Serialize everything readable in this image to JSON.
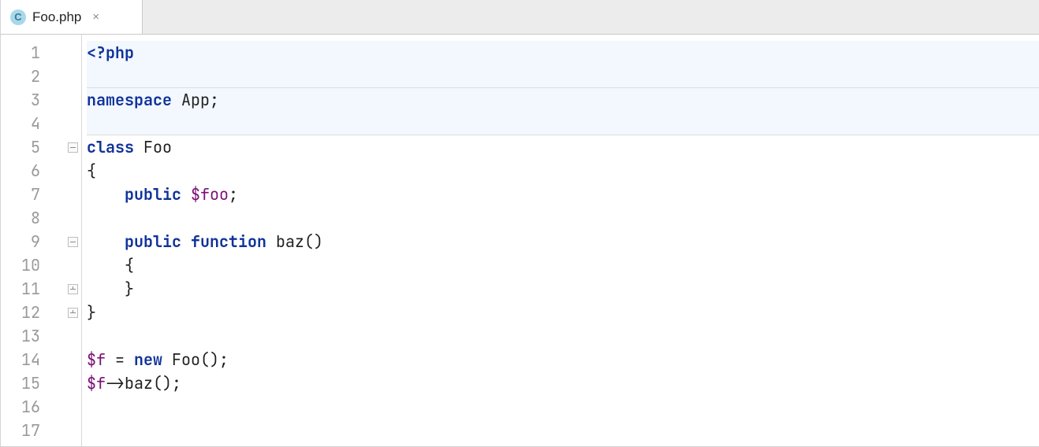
{
  "tab": {
    "icon_letter": "C",
    "filename": "Foo.php",
    "close_glyph": "×"
  },
  "editor": {
    "line_count": 17,
    "highlighted_lines": [
      1,
      2,
      3,
      4
    ],
    "fold_markers": {
      "5": "open",
      "9": "open",
      "11": "close",
      "12": "close"
    },
    "code": {
      "l1": {
        "open": "<?php"
      },
      "l3": {
        "kw": "namespace",
        "name": " App",
        "end": ";"
      },
      "l5": {
        "kw": "class",
        "name": " Foo"
      },
      "l6": {
        "brace": "{"
      },
      "l7": {
        "indent": "    ",
        "kw": "public",
        "sp": " ",
        "var": "$foo",
        "end": ";"
      },
      "l9": {
        "indent": "    ",
        "kw1": "public",
        "sp1": " ",
        "kw2": "function",
        "name": " baz",
        "paren": "()"
      },
      "l10": {
        "indent": "    ",
        "brace": "{"
      },
      "l11": {
        "indent": "    ",
        "brace": "}"
      },
      "l12": {
        "brace": "}"
      },
      "l14": {
        "var": "$f",
        "sp": " = ",
        "kw": "new",
        "name": " Foo",
        "paren": "()",
        "end": ";"
      },
      "l15": {
        "var": "$f",
        "arrow": "->",
        "call": "baz()",
        "end": ";"
      }
    }
  }
}
